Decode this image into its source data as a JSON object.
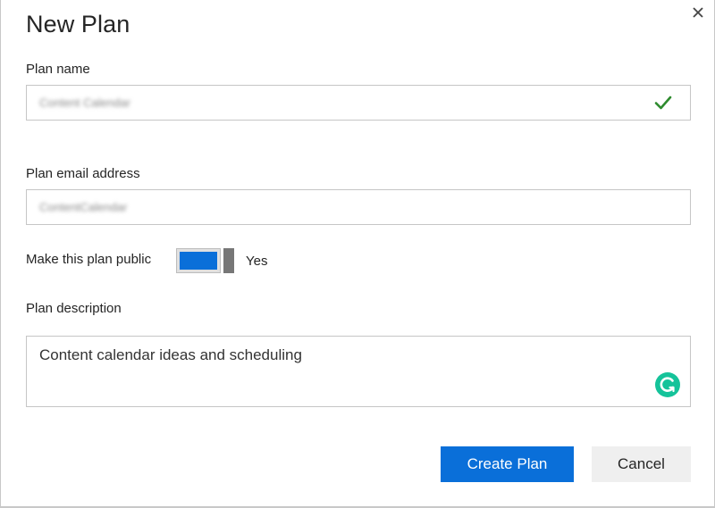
{
  "dialog": {
    "title": "New Plan",
    "close_icon": "close-icon"
  },
  "plan_name": {
    "label": "Plan name",
    "value": "Content Calendar",
    "valid_icon": "checkmark-icon",
    "valid_color": "#2e8b2e"
  },
  "plan_email": {
    "label": "Plan email address",
    "value": "ContentCalendar"
  },
  "public_toggle": {
    "label": "Make this plan public",
    "state_label": "Yes",
    "on": true,
    "accent_color": "#0a6fd9"
  },
  "description": {
    "label": "Plan description",
    "value": "Content calendar ideas and scheduling",
    "assistant_icon": "grammarly-icon",
    "assistant_color": "#15c39a"
  },
  "actions": {
    "create_label": "Create Plan",
    "cancel_label": "Cancel"
  }
}
